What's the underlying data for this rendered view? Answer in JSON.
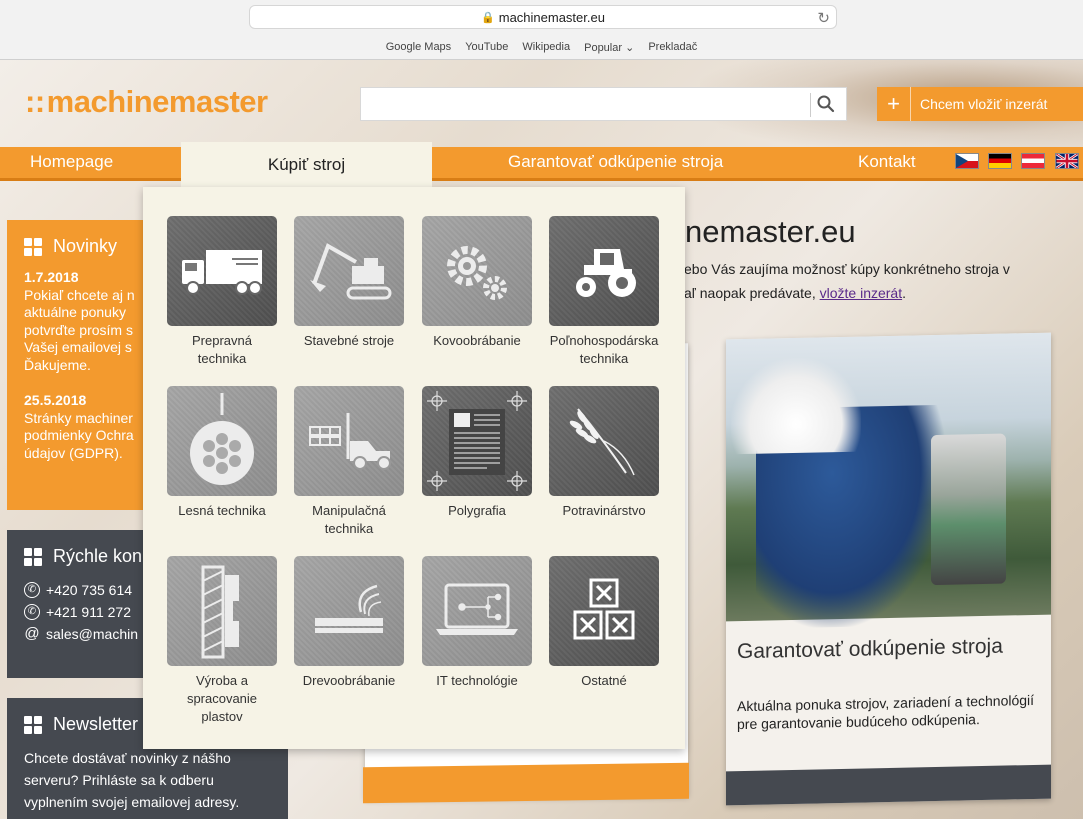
{
  "browser": {
    "url": "machinemaster.eu",
    "bookmarks": [
      "Google Maps",
      "YouTube",
      "Wikipedia",
      "Popular",
      "Prekladač"
    ]
  },
  "header": {
    "logo": "machinemaster",
    "search": {
      "value": "",
      "placeholder": ""
    },
    "add_button": "Chcem vložiť inzerát"
  },
  "nav": {
    "items": [
      "Homepage",
      "Kúpiť stroj",
      "Garantovať odkúpenie stroja",
      "Kontakt"
    ],
    "languages": [
      "cz",
      "de",
      "at",
      "uk"
    ]
  },
  "dropdown": {
    "categories": [
      {
        "label": "Prepravná technika",
        "icon": "truck-icon"
      },
      {
        "label": "Stavebné stroje",
        "icon": "excavator-icon"
      },
      {
        "label": "Kovoobrábanie",
        "icon": "gears-icon"
      },
      {
        "label": "Poľnohospodárska technika",
        "icon": "tractor-icon"
      },
      {
        "label": "Lesná technika",
        "icon": "logs-icon"
      },
      {
        "label": "Manipulačná technika",
        "icon": "forklift-icon"
      },
      {
        "label": "Polygrafia",
        "icon": "print-sheet-icon"
      },
      {
        "label": "Potravinárstvo",
        "icon": "wheat-icon"
      },
      {
        "label": "Výroba a spracovanie plastov",
        "icon": "plastic-profile-icon"
      },
      {
        "label": "Drevoobrábanie",
        "icon": "wood-plank-icon"
      },
      {
        "label": "IT technológie",
        "icon": "laptop-icon"
      },
      {
        "label": "Ostatné",
        "icon": "boxes-icon"
      }
    ]
  },
  "sidebar": {
    "news": {
      "title": "Novinky",
      "items": [
        {
          "date": "1.7.2018",
          "lines": [
            "Pokiaľ chcete aj n",
            "aktuálne ponuky",
            "potvrďte prosím s",
            "Vašej emailovej s",
            "Ďakujeme."
          ]
        },
        {
          "date": "25.5.2018",
          "lines": [
            "Stránky machiner",
            "podmienky Ochra",
            "údajov (GDPR)."
          ]
        }
      ]
    },
    "contact": {
      "title": "Rýchle kon",
      "phones": [
        "+420 735 614",
        "+421 911 272"
      ],
      "email": "sales@machin"
    },
    "newsletter": {
      "title": "Newsletter",
      "text": "Chcete dostávať novinky z nášho serveru? Prihláste sa k odberu vyplnením svojej emailovej adresy."
    }
  },
  "main": {
    "title": "nemaster.eu",
    "intro_line1": "ebo Vás zaujíma možnosť kúpy konkrétneho stroja v",
    "intro_line2_pre": "aľ naopak predávate, ",
    "intro_link": "vložte inzerát",
    "intro_line2_post": "."
  },
  "right_card": {
    "title": "Garantovať odkúpenie stroja",
    "text": "Aktuálna ponuka strojov, zariadení a technológií pre garantovanie budúceho odkúpenia."
  }
}
